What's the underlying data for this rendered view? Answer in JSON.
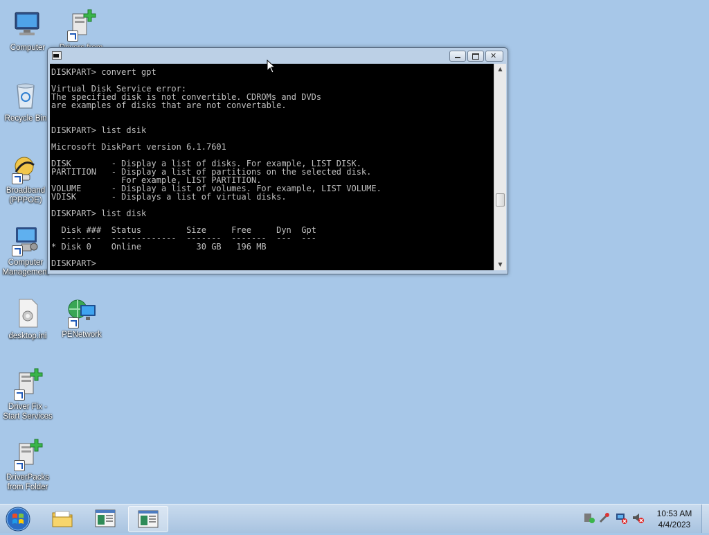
{
  "desktop": {
    "icons": [
      {
        "label": "Computer",
        "icon": "computer-icon"
      },
      {
        "label": "Drivers from",
        "icon": "drivers-shortcut-icon"
      },
      {
        "label": "Recycle Bin",
        "icon": "recycle-bin-icon"
      },
      {
        "label": "Broadband (PPPOE)",
        "icon": "broadband-icon"
      },
      {
        "label": "Computer Management",
        "icon": "computer-management-icon"
      },
      {
        "label": "desktop.ini",
        "icon": "ini-file-icon"
      },
      {
        "label": "PENetwork",
        "icon": "network-icon"
      },
      {
        "label": "Driver Fix - Start Services",
        "icon": "driver-fix-icon"
      },
      {
        "label": "DriverPacks from Folder",
        "icon": "driverpacks-icon"
      }
    ]
  },
  "console": {
    "lines": [
      "DISKPART> convert gpt",
      "",
      "Virtual Disk Service error:",
      "The specified disk is not convertible. CDROMs and DVDs",
      "are examples of disks that are not convertable.",
      "",
      "",
      "DISKPART> list dsik",
      "",
      "Microsoft DiskPart version 6.1.7601",
      "",
      "DISK        - Display a list of disks. For example, LIST DISK.",
      "PARTITION   - Display a list of partitions on the selected disk.",
      "              For example, LIST PARTITION.",
      "VOLUME      - Display a list of volumes. For example, LIST VOLUME.",
      "VDISK       - Displays a list of virtual disks.",
      "",
      "DISKPART> list disk",
      "",
      "  Disk ###  Status         Size     Free     Dyn  Gpt",
      "  --------  -------------  -------  -------  ---  ---",
      "* Disk 0    Online           30 GB   196 MB",
      "",
      "DISKPART> "
    ]
  },
  "taskbar": {
    "clock_time": "10:53 AM",
    "clock_date": "4/4/2023"
  }
}
